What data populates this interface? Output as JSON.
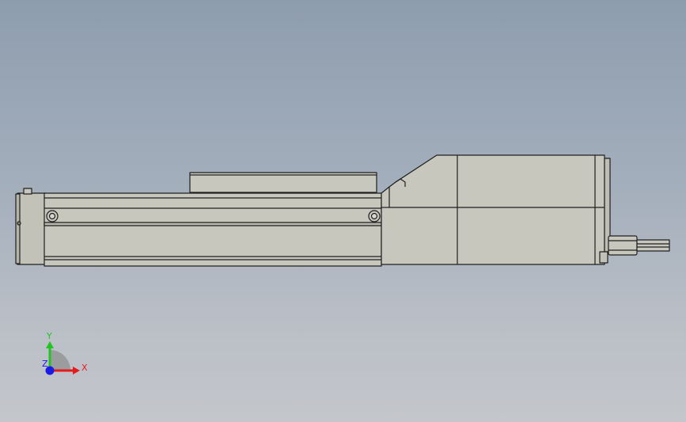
{
  "viewport": {
    "background_top": "#8e9dae",
    "background_bottom": "#c4c6cb"
  },
  "model": {
    "body_color": "#c7c7bd",
    "body_shade": "#b9b9ae",
    "edge_color": "#1f1f1f"
  },
  "triad": {
    "x_label": "X",
    "y_label": "Y",
    "z_label": "Z",
    "x_color": "#e51a1a",
    "y_color": "#22c422",
    "z_color": "#1a1ae5"
  }
}
